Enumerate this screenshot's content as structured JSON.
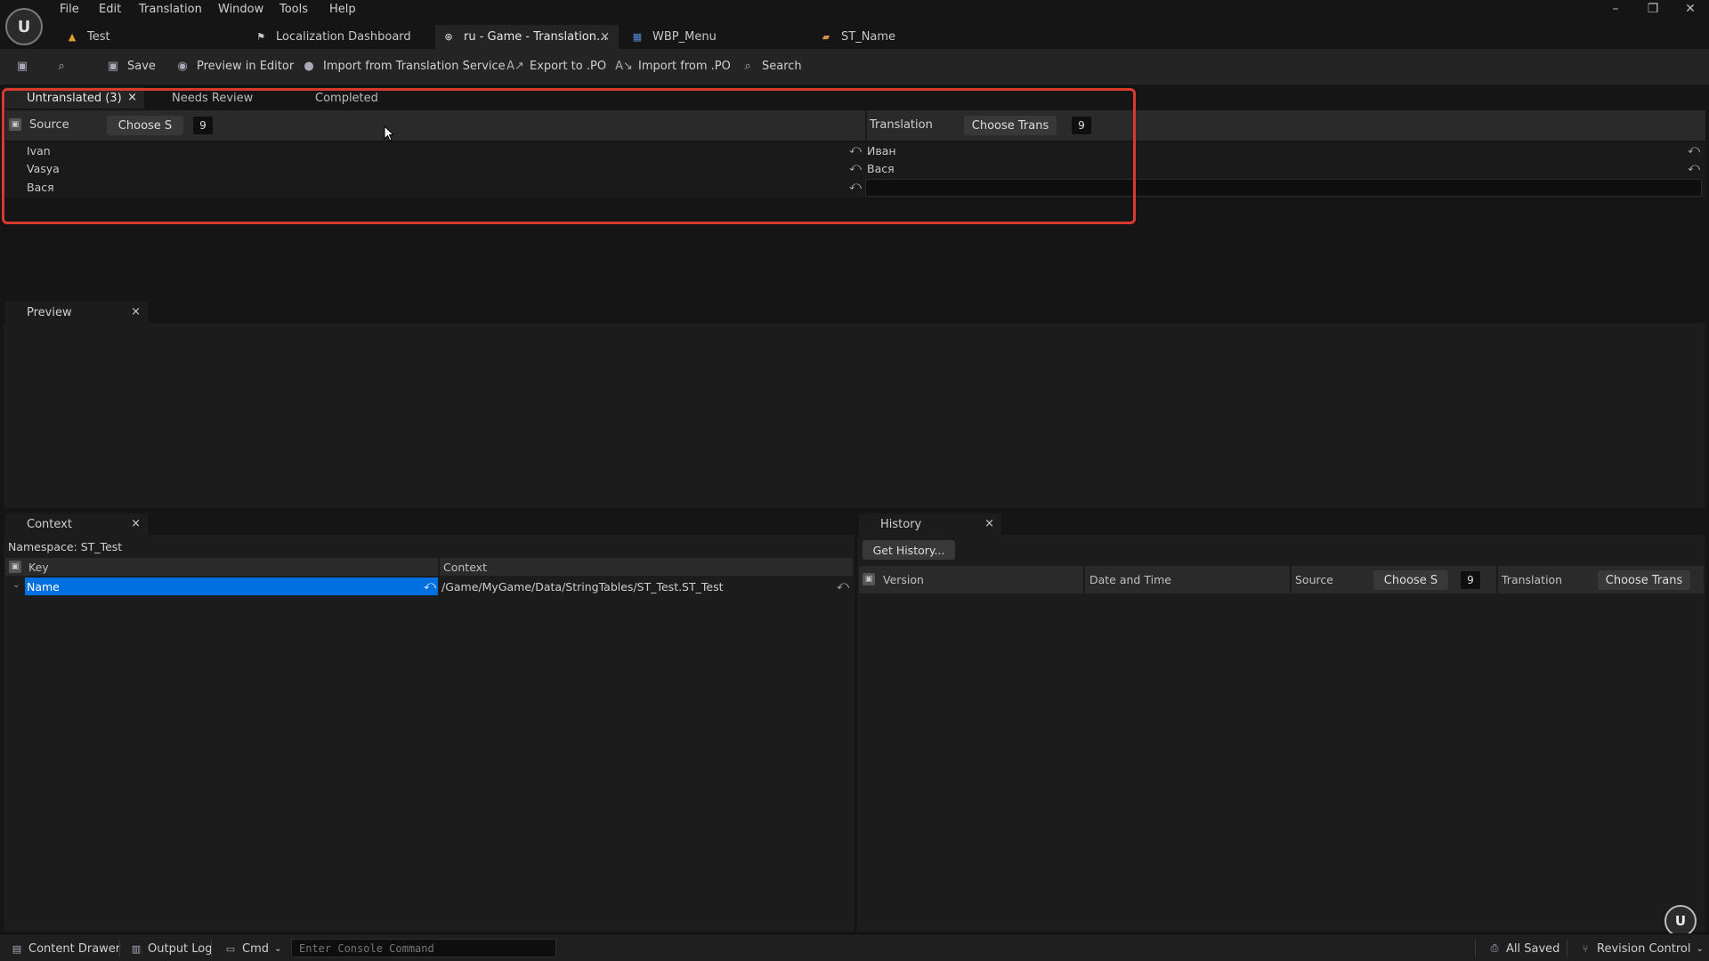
{
  "app": {
    "logo": "U",
    "menu": [
      "File",
      "Edit",
      "Translation",
      "Window",
      "Tools",
      "Help"
    ],
    "window_controls": {
      "minimize": "–",
      "restore": "❐",
      "close": "✕"
    }
  },
  "doc_tabs": [
    {
      "label": "Test",
      "icon": "level-icon"
    },
    {
      "label": "Localization Dashboard",
      "icon": "flag-icon"
    },
    {
      "label": "ru - Game - Translation...",
      "icon": "translation-icon",
      "close": "×"
    },
    {
      "label": "WBP_Menu",
      "icon": "widget-icon"
    },
    {
      "label": "ST_Name",
      "icon": "string-table-icon"
    }
  ],
  "toolbar": {
    "save": "Save",
    "preview": "Preview in Editor",
    "import_service": "Import from Translation Service",
    "export_po": "Export to .PO",
    "import_po": "Import from .PO",
    "search": "Search"
  },
  "translation_panel": {
    "tabs": [
      {
        "label": "Untranslated (3)",
        "close": "×"
      },
      {
        "label": "Needs Review"
      },
      {
        "label": "Completed"
      }
    ],
    "source_header": "Source",
    "source_button": "Choose S",
    "source_font_size": "9",
    "translation_header": "Translation",
    "translation_button": "Choose Trans",
    "translation_font_size": "9",
    "rows": [
      {
        "source": "Ivan",
        "translation": "Иван"
      },
      {
        "source": "Vasya",
        "translation": "Вася"
      },
      {
        "source": "Вася",
        "translation": ""
      }
    ],
    "revert_glyph": "⤺"
  },
  "preview_panel": {
    "tab": "Preview",
    "close": "×"
  },
  "context_panel": {
    "tab": "Context",
    "close": "×",
    "namespace": "Namespace: ST_Test",
    "col_key": "Key",
    "col_context": "Context",
    "rows": [
      {
        "key": "Name",
        "context": "/Game/MyGame/Data/StringTables/ST_Test.ST_Test"
      }
    ]
  },
  "history_panel": {
    "tab": "History",
    "close": "×",
    "get_history": "Get History...",
    "col_version": "Version",
    "col_datetime": "Date and Time",
    "col_source": "Source",
    "source_button": "Choose S",
    "source_font_size": "9",
    "col_translation": "Translation",
    "translation_button": "Choose Trans"
  },
  "statusbar": {
    "content_drawer": "Content Drawer",
    "output_log": "Output Log",
    "cmd": "Cmd",
    "console_placeholder": "Enter Console Command",
    "all_saved": "All Saved",
    "revision_control": "Revision Control"
  },
  "colors": {
    "highlight": "#d93a30",
    "selection": "#0070e0"
  }
}
